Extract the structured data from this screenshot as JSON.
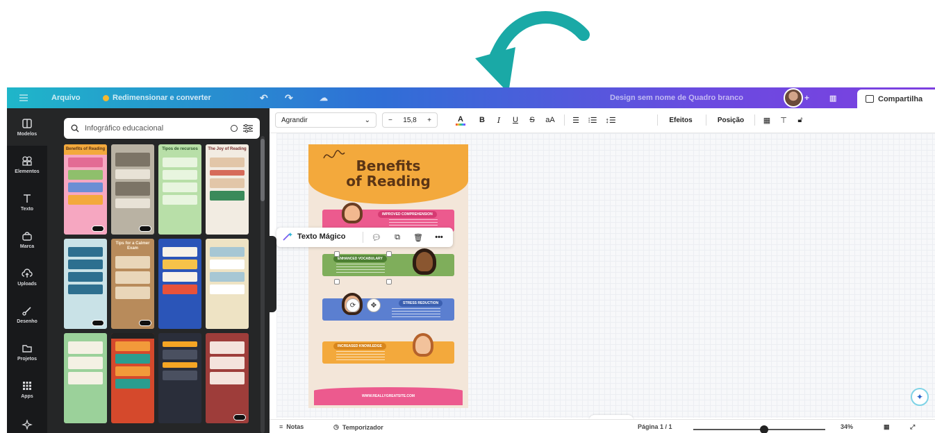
{
  "topbar": {
    "file_label": "Arquivo",
    "resize_label": "Redimensionar e converter",
    "design_title": "Design sem nome de Quadro branco",
    "share_label": "Compartilha"
  },
  "rail": {
    "items": [
      {
        "label": "Modelos",
        "icon": "template-icon"
      },
      {
        "label": "Elementos",
        "icon": "elements-icon"
      },
      {
        "label": "Texto",
        "icon": "text-icon"
      },
      {
        "label": "Marca",
        "icon": "brand-icon"
      },
      {
        "label": "Uploads",
        "icon": "upload-icon"
      },
      {
        "label": "Desenho",
        "icon": "draw-icon"
      },
      {
        "label": "Projetos",
        "icon": "folder-icon"
      },
      {
        "label": "Apps",
        "icon": "apps-icon"
      }
    ]
  },
  "panel": {
    "search_value": "Infográfico educacional",
    "thumbs": [
      {
        "title": "Benefits of Reading",
        "bg": "#f6a7c1"
      },
      {
        "title": "",
        "bg": "#b9b2a3"
      },
      {
        "title": "Tipos de recursos",
        "bg": "#b8dfa8"
      },
      {
        "title": "The Joy of Reading",
        "bg": "#f2ece2"
      },
      {
        "title": "",
        "bg": "#c9e2e7"
      },
      {
        "title": "Tips for a Calmer Exam",
        "bg": "#b88b5b"
      },
      {
        "title": "",
        "bg": "#2b55b8"
      },
      {
        "title": "",
        "bg": "#eee3c4"
      },
      {
        "title": "",
        "bg": "#9bd19a"
      },
      {
        "title": "",
        "bg": "#d5492c"
      },
      {
        "title": "",
        "bg": "#2a2e3a"
      },
      {
        "title": "",
        "bg": "#9e3d3a"
      }
    ]
  },
  "toolbar": {
    "font_name": "Agrandir",
    "font_size": "15,8",
    "effects_label": "Efeitos",
    "position_label": "Posição",
    "case_label": "aA"
  },
  "context_menu": {
    "magic_text_label": "Texto Mágico"
  },
  "infographic": {
    "title_line1": "Benefits",
    "title_line2": "of Reading",
    "sections": [
      "IMPROVED COMPREHENSION",
      "ENHANCED VOCABULARY",
      "STRESS REDUCTION",
      "INCREASED KNOWLEDGE"
    ],
    "url": "WWW.REALLYGREATSITE.COM"
  },
  "footer": {
    "notes_label": "Notas",
    "timer_label": "Temporizador",
    "page_label": "Página 1 / 1",
    "zoom_label": "34%"
  },
  "colors": {
    "accent_teal": "#1aa9a6",
    "rail_bg": "#18191b",
    "panel_bg": "#252627"
  }
}
